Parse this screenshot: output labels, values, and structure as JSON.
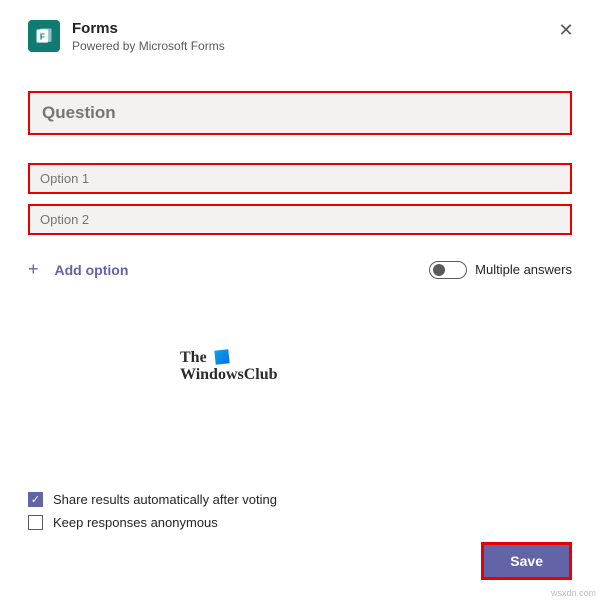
{
  "header": {
    "title": "Forms",
    "subtitle": "Powered by Microsoft Forms"
  },
  "inputs": {
    "question_placeholder": "Question",
    "option1_placeholder": "Option 1",
    "option2_placeholder": "Option 2"
  },
  "actions": {
    "add_option": "Add option",
    "multiple_answers": "Multiple answers",
    "save": "Save"
  },
  "settings": {
    "share_results": "Share results automatically after voting",
    "keep_anonymous": "Keep responses anonymous"
  },
  "watermark": {
    "line1": "The",
    "line2": "WindowsClub"
  },
  "attribution": "wsxdn.com"
}
